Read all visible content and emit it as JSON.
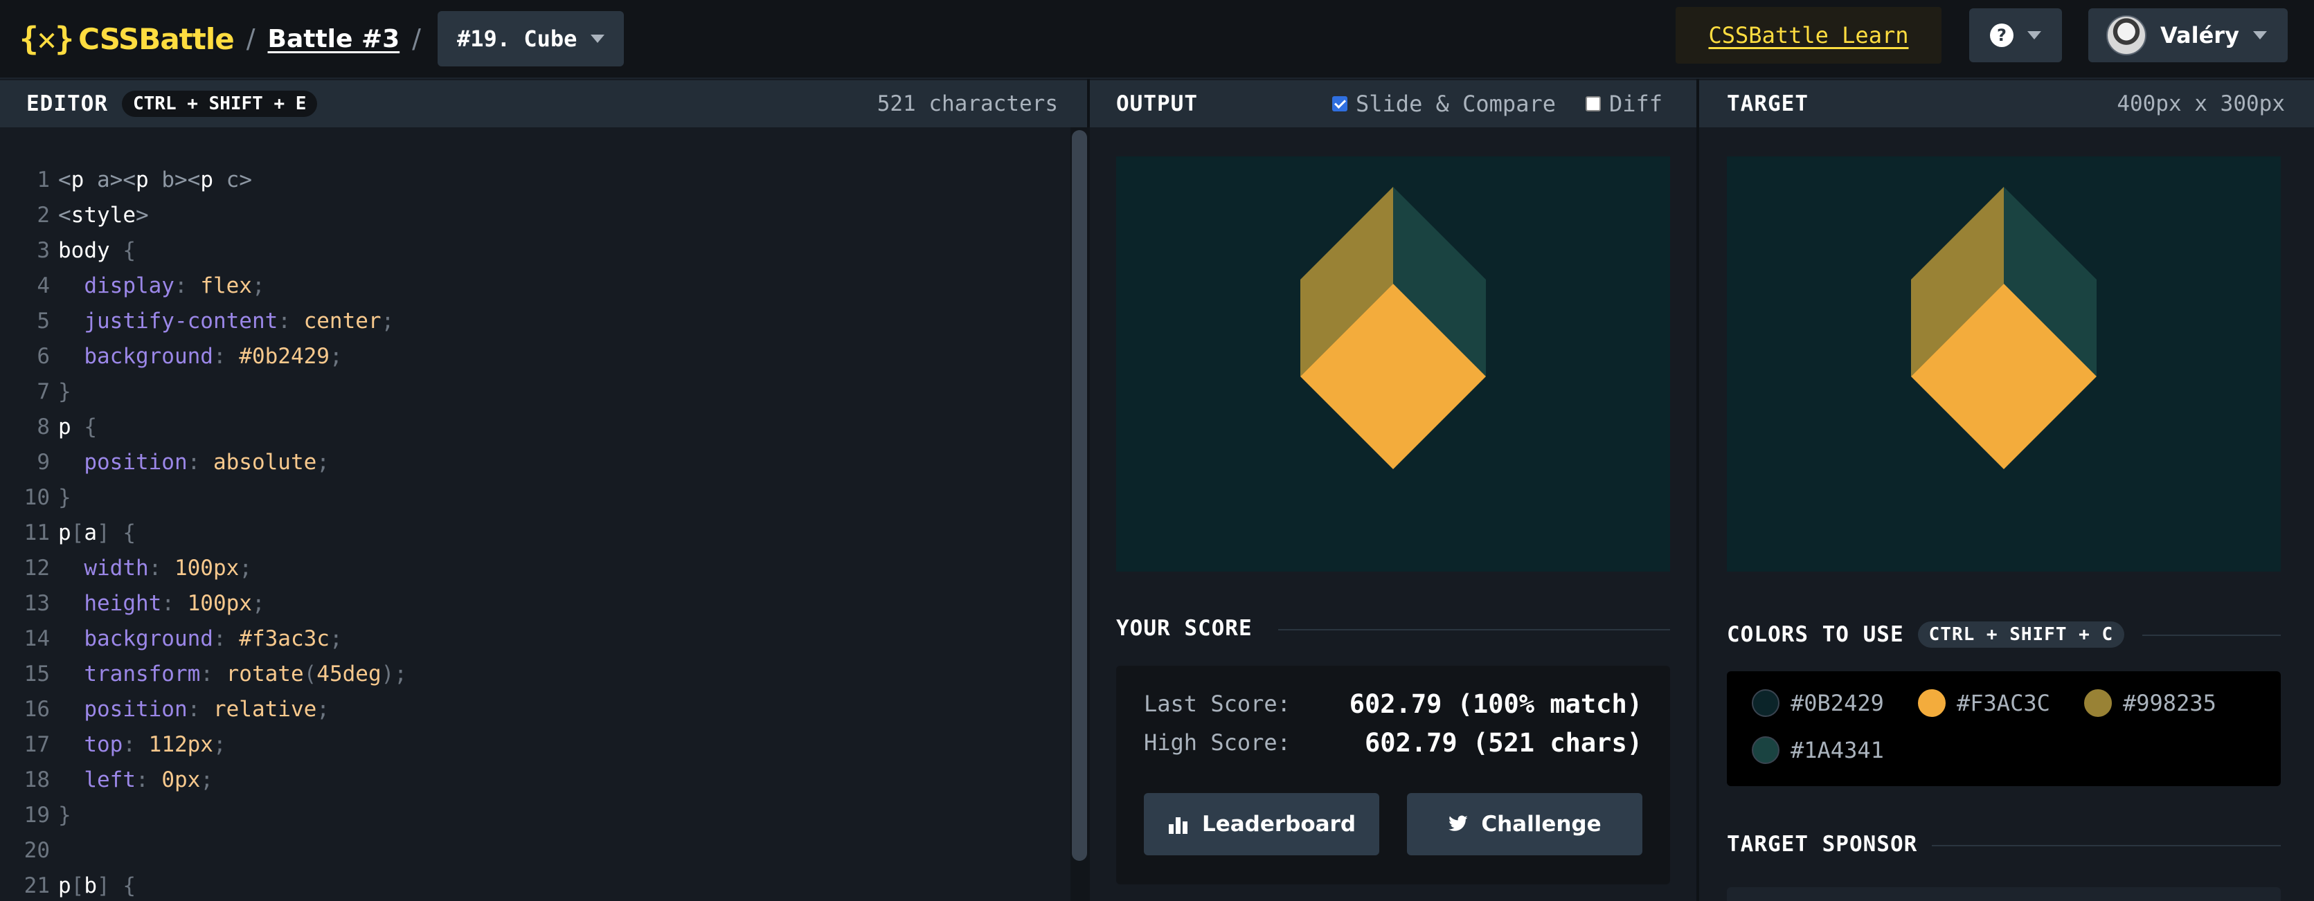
{
  "header": {
    "logo_mark": "{✕}",
    "logo_text": "CSSBattle",
    "sep1": "/",
    "battle_label": "Battle #3",
    "sep2": "/",
    "target_label": "#19. Cube",
    "learn_label": "CSSBattle Learn",
    "help_symbol": "?",
    "user_name": "Valéry"
  },
  "editor": {
    "title": "EDITOR",
    "shortcut": "CTRL + SHIFT + E",
    "char_count": "521 characters",
    "lines": [
      {
        "n": "1",
        "parts": [
          [
            "t-tag",
            "<"
          ],
          [
            "t-txt",
            "p"
          ],
          [
            "t-tag",
            " a><"
          ],
          [
            "t-txt",
            "p"
          ],
          [
            "t-tag",
            " b><"
          ],
          [
            "t-txt",
            "p"
          ],
          [
            "t-tag",
            " c>"
          ]
        ]
      },
      {
        "n": "2",
        "parts": [
          [
            "t-tag",
            "<"
          ],
          [
            "t-txt",
            "style"
          ],
          [
            "t-tag",
            ">"
          ]
        ]
      },
      {
        "n": "3",
        "parts": [
          [
            "t-txt",
            "body "
          ],
          [
            "t-punc",
            "{"
          ]
        ]
      },
      {
        "n": "4",
        "parts": [
          [
            "t-prop",
            "  display"
          ],
          [
            "t-punc",
            ": "
          ],
          [
            "t-val",
            "flex"
          ],
          [
            "t-punc",
            ";"
          ]
        ]
      },
      {
        "n": "5",
        "parts": [
          [
            "t-prop",
            "  justify-content"
          ],
          [
            "t-punc",
            ": "
          ],
          [
            "t-val",
            "center"
          ],
          [
            "t-punc",
            ";"
          ]
        ]
      },
      {
        "n": "6",
        "parts": [
          [
            "t-prop",
            "  background"
          ],
          [
            "t-punc",
            ": "
          ],
          [
            "t-val",
            "#0b2429"
          ],
          [
            "t-punc",
            ";"
          ]
        ]
      },
      {
        "n": "7",
        "parts": [
          [
            "t-punc",
            "}"
          ]
        ]
      },
      {
        "n": "8",
        "parts": [
          [
            "t-txt",
            "p "
          ],
          [
            "t-punc",
            "{"
          ]
        ]
      },
      {
        "n": "9",
        "parts": [
          [
            "t-prop",
            "  position"
          ],
          [
            "t-punc",
            ": "
          ],
          [
            "t-val",
            "absolute"
          ],
          [
            "t-punc",
            ";"
          ]
        ]
      },
      {
        "n": "10",
        "parts": [
          [
            "t-punc",
            "}"
          ]
        ]
      },
      {
        "n": "11",
        "parts": [
          [
            "t-txt",
            "p"
          ],
          [
            "t-punc",
            "["
          ],
          [
            "t-txt",
            "a"
          ],
          [
            "t-punc",
            "] {"
          ]
        ]
      },
      {
        "n": "12",
        "parts": [
          [
            "t-prop",
            "  width"
          ],
          [
            "t-punc",
            ": "
          ],
          [
            "t-val",
            "100px"
          ],
          [
            "t-punc",
            ";"
          ]
        ]
      },
      {
        "n": "13",
        "parts": [
          [
            "t-prop",
            "  height"
          ],
          [
            "t-punc",
            ": "
          ],
          [
            "t-val",
            "100px"
          ],
          [
            "t-punc",
            ";"
          ]
        ]
      },
      {
        "n": "14",
        "parts": [
          [
            "t-prop",
            "  background"
          ],
          [
            "t-punc",
            ": "
          ],
          [
            "t-val",
            "#f3ac3c"
          ],
          [
            "t-punc",
            ";"
          ]
        ]
      },
      {
        "n": "15",
        "parts": [
          [
            "t-prop",
            "  transform"
          ],
          [
            "t-punc",
            ": "
          ],
          [
            "t-val",
            "rotate"
          ],
          [
            "t-punc",
            "("
          ],
          [
            "t-val",
            "45deg"
          ],
          [
            "t-punc",
            ");"
          ]
        ]
      },
      {
        "n": "16",
        "parts": [
          [
            "t-prop",
            "  position"
          ],
          [
            "t-punc",
            ": "
          ],
          [
            "t-val",
            "relative"
          ],
          [
            "t-punc",
            ";"
          ]
        ]
      },
      {
        "n": "17",
        "parts": [
          [
            "t-prop",
            "  top"
          ],
          [
            "t-punc",
            ": "
          ],
          [
            "t-val",
            "112px"
          ],
          [
            "t-punc",
            ";"
          ]
        ]
      },
      {
        "n": "18",
        "parts": [
          [
            "t-prop",
            "  left"
          ],
          [
            "t-punc",
            ": "
          ],
          [
            "t-val",
            "0px"
          ],
          [
            "t-punc",
            ";"
          ]
        ]
      },
      {
        "n": "19",
        "parts": [
          [
            "t-punc",
            "}"
          ]
        ]
      },
      {
        "n": "20",
        "parts": []
      },
      {
        "n": "21",
        "parts": [
          [
            "t-txt",
            "p"
          ],
          [
            "t-punc",
            "["
          ],
          [
            "t-txt",
            "b"
          ],
          [
            "t-punc",
            "] {"
          ]
        ]
      }
    ]
  },
  "output": {
    "title": "OUTPUT",
    "slide_compare_label": "Slide & Compare",
    "slide_compare_checked": true,
    "diff_label": "Diff",
    "diff_checked": false
  },
  "target": {
    "title": "TARGET",
    "size_label": "400px x 300px"
  },
  "score": {
    "title": "YOUR SCORE",
    "last_label": "Last Score:",
    "last_value": "602.79 (100% match)",
    "high_label": "High Score:",
    "high_value": "602.79 (521 chars)",
    "leaderboard_label": "Leaderboard",
    "challenge_label": "Challenge"
  },
  "colors": {
    "title": "COLORS TO USE",
    "shortcut": "CTRL + SHIFT + C",
    "swatches": [
      {
        "hex": "#0B2429"
      },
      {
        "hex": "#F3AC3C"
      },
      {
        "hex": "#998235"
      },
      {
        "hex": "#1A4341"
      }
    ]
  },
  "sponsor": {
    "title": "TARGET SPONSOR"
  },
  "theme": {
    "cube_top": "#998235",
    "cube_right": "#1a4341",
    "cube_front": "#f3ac3c",
    "canvas_bg": "#0b2429"
  }
}
